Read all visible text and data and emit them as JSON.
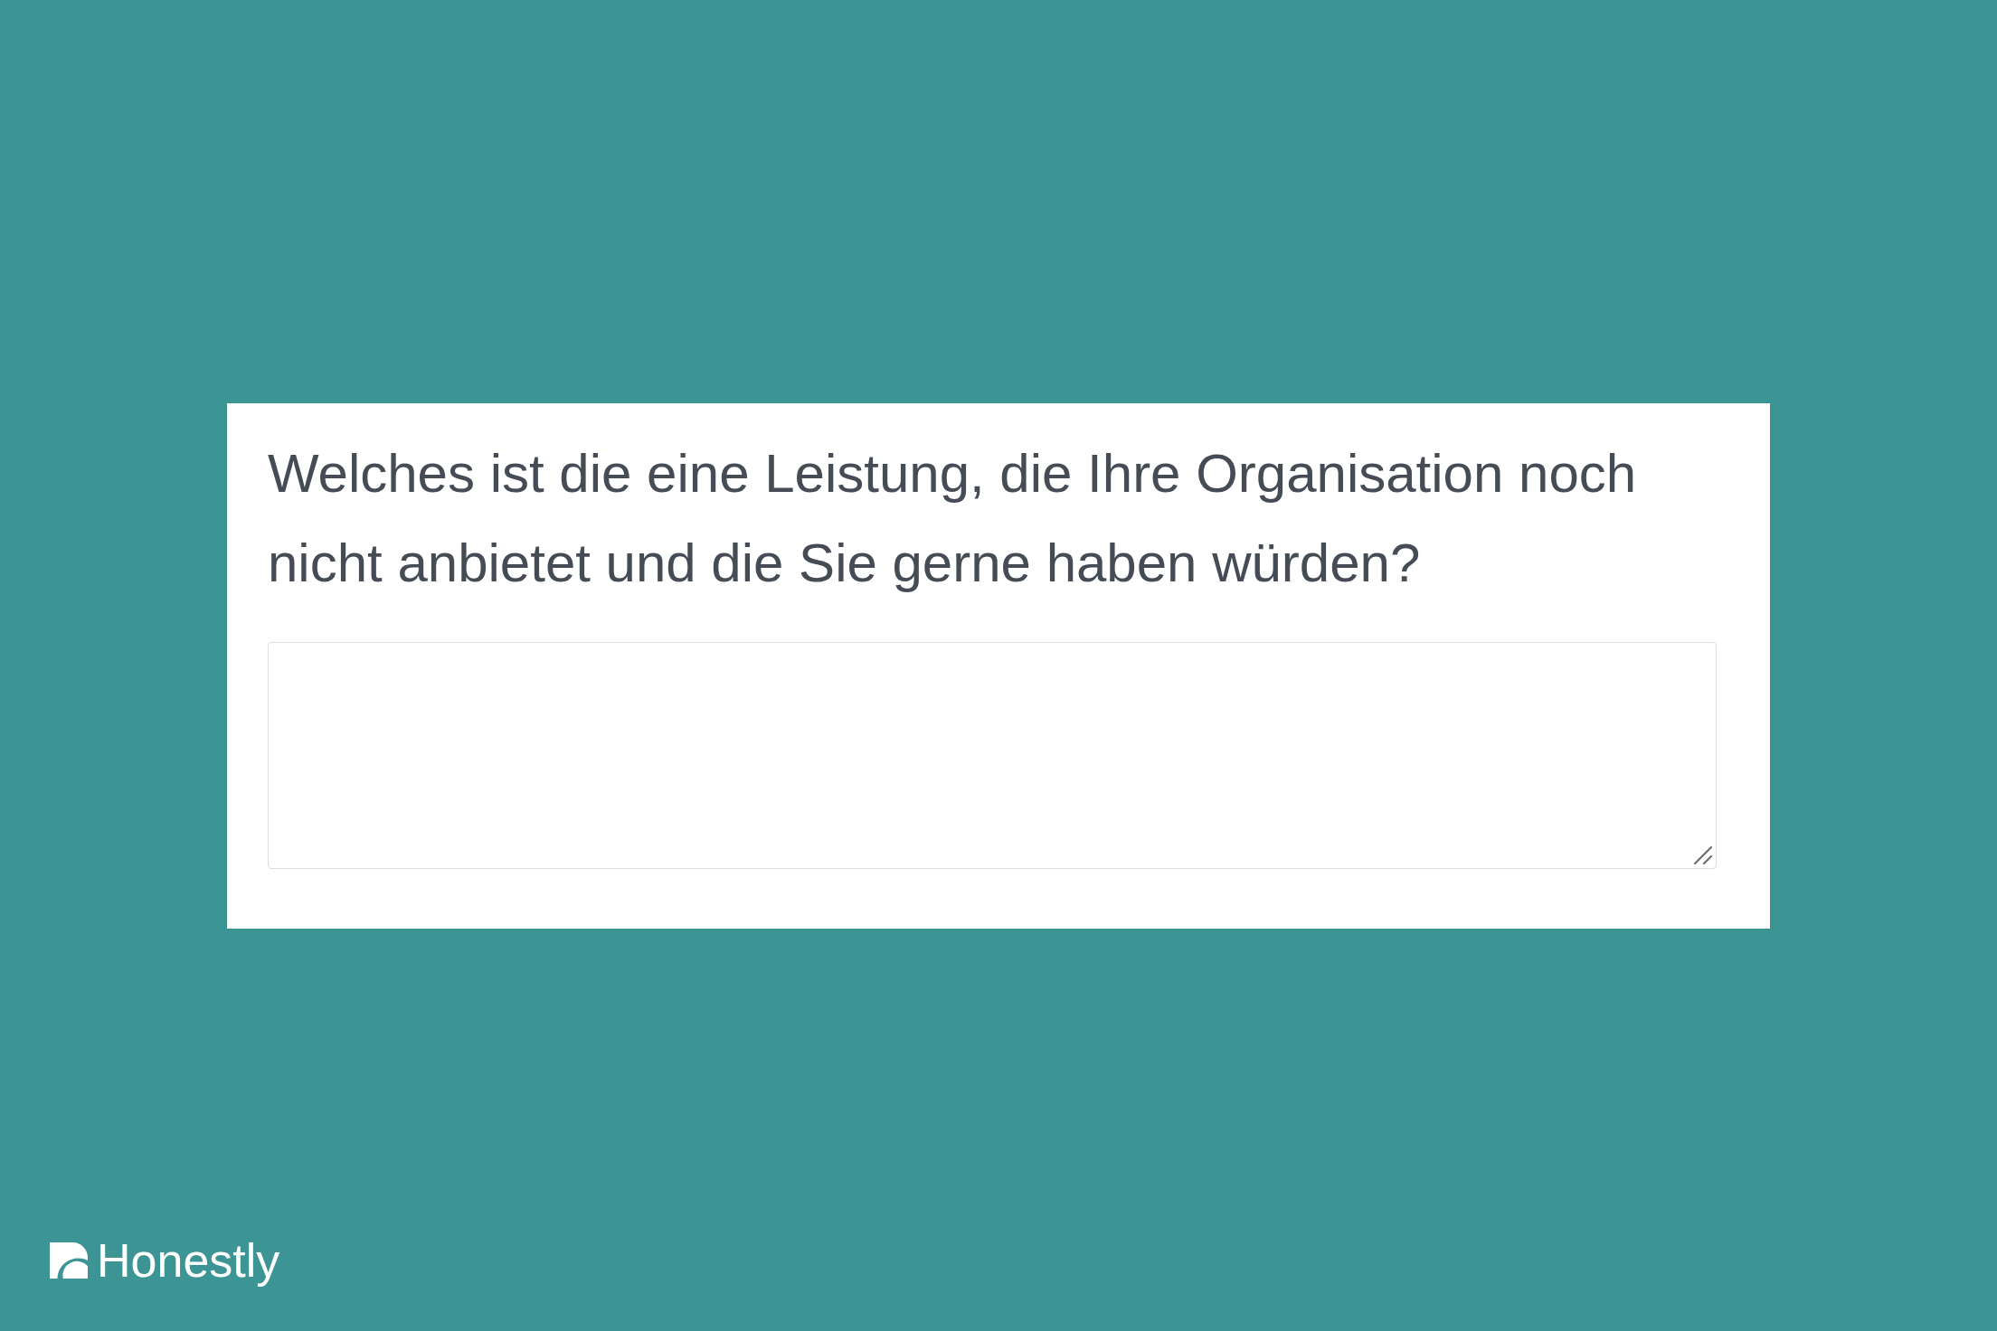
{
  "question": {
    "text": "Welches ist die eine Leistung, die Ihre Organisation noch nicht anbietet und die Sie gerne haben würden?"
  },
  "answer_box": {
    "resizable": true
  },
  "brand": {
    "name": "Honestly"
  }
}
